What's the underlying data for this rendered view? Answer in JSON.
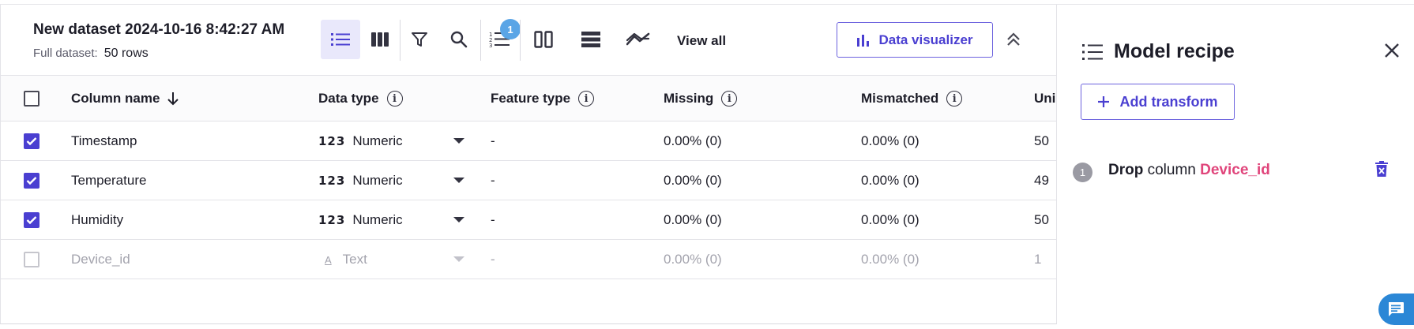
{
  "dataset": {
    "title": "New dataset 2024-10-16 8:42:27 AM",
    "full_label": "Full dataset:",
    "rows_label": "50 rows"
  },
  "toolbar": {
    "icons": [
      "list-view-icon",
      "column-view-icon",
      "filter-icon",
      "search-icon",
      "recipe-list-icon",
      "split-view-icon",
      "rows-icon",
      "trend-icon"
    ],
    "recipe_badge": "1",
    "view_all": "View all",
    "data_visualizer": "Data visualizer"
  },
  "table": {
    "headers": {
      "column_name": "Column name",
      "data_type": "Data type",
      "feature_type": "Feature type",
      "missing": "Missing",
      "mismatched": "Mismatched",
      "unique": "Uni"
    },
    "rows": [
      {
        "name": "Timestamp",
        "type_icon": "123",
        "type": "Numeric",
        "feature": "-",
        "missing": "0.00% (0)",
        "mismatched": "0.00% (0)",
        "unique": "50",
        "checked": true
      },
      {
        "name": "Temperature",
        "type_icon": "123",
        "type": "Numeric",
        "feature": "-",
        "missing": "0.00% (0)",
        "mismatched": "0.00% (0)",
        "unique": "49",
        "checked": true
      },
      {
        "name": "Humidity",
        "type_icon": "123",
        "type": "Numeric",
        "feature": "-",
        "missing": "0.00% (0)",
        "mismatched": "0.00% (0)",
        "unique": "50",
        "checked": true
      },
      {
        "name": "Device_id",
        "type_icon": "A",
        "type": "Text",
        "feature": "-",
        "missing": "0.00% (0)",
        "mismatched": "0.00% (0)",
        "unique": "1",
        "checked": false
      }
    ]
  },
  "recipe": {
    "title": "Model recipe",
    "add_transform": "Add transform",
    "steps": [
      {
        "number": "1",
        "verb": "Drop",
        "middle": "column",
        "column": "Device_id"
      }
    ]
  },
  "colors": {
    "accent": "#4a3fd1",
    "badge": "#5aa5e6",
    "column_highlight": "#e0457b",
    "chat_fab": "#2b87d6"
  }
}
